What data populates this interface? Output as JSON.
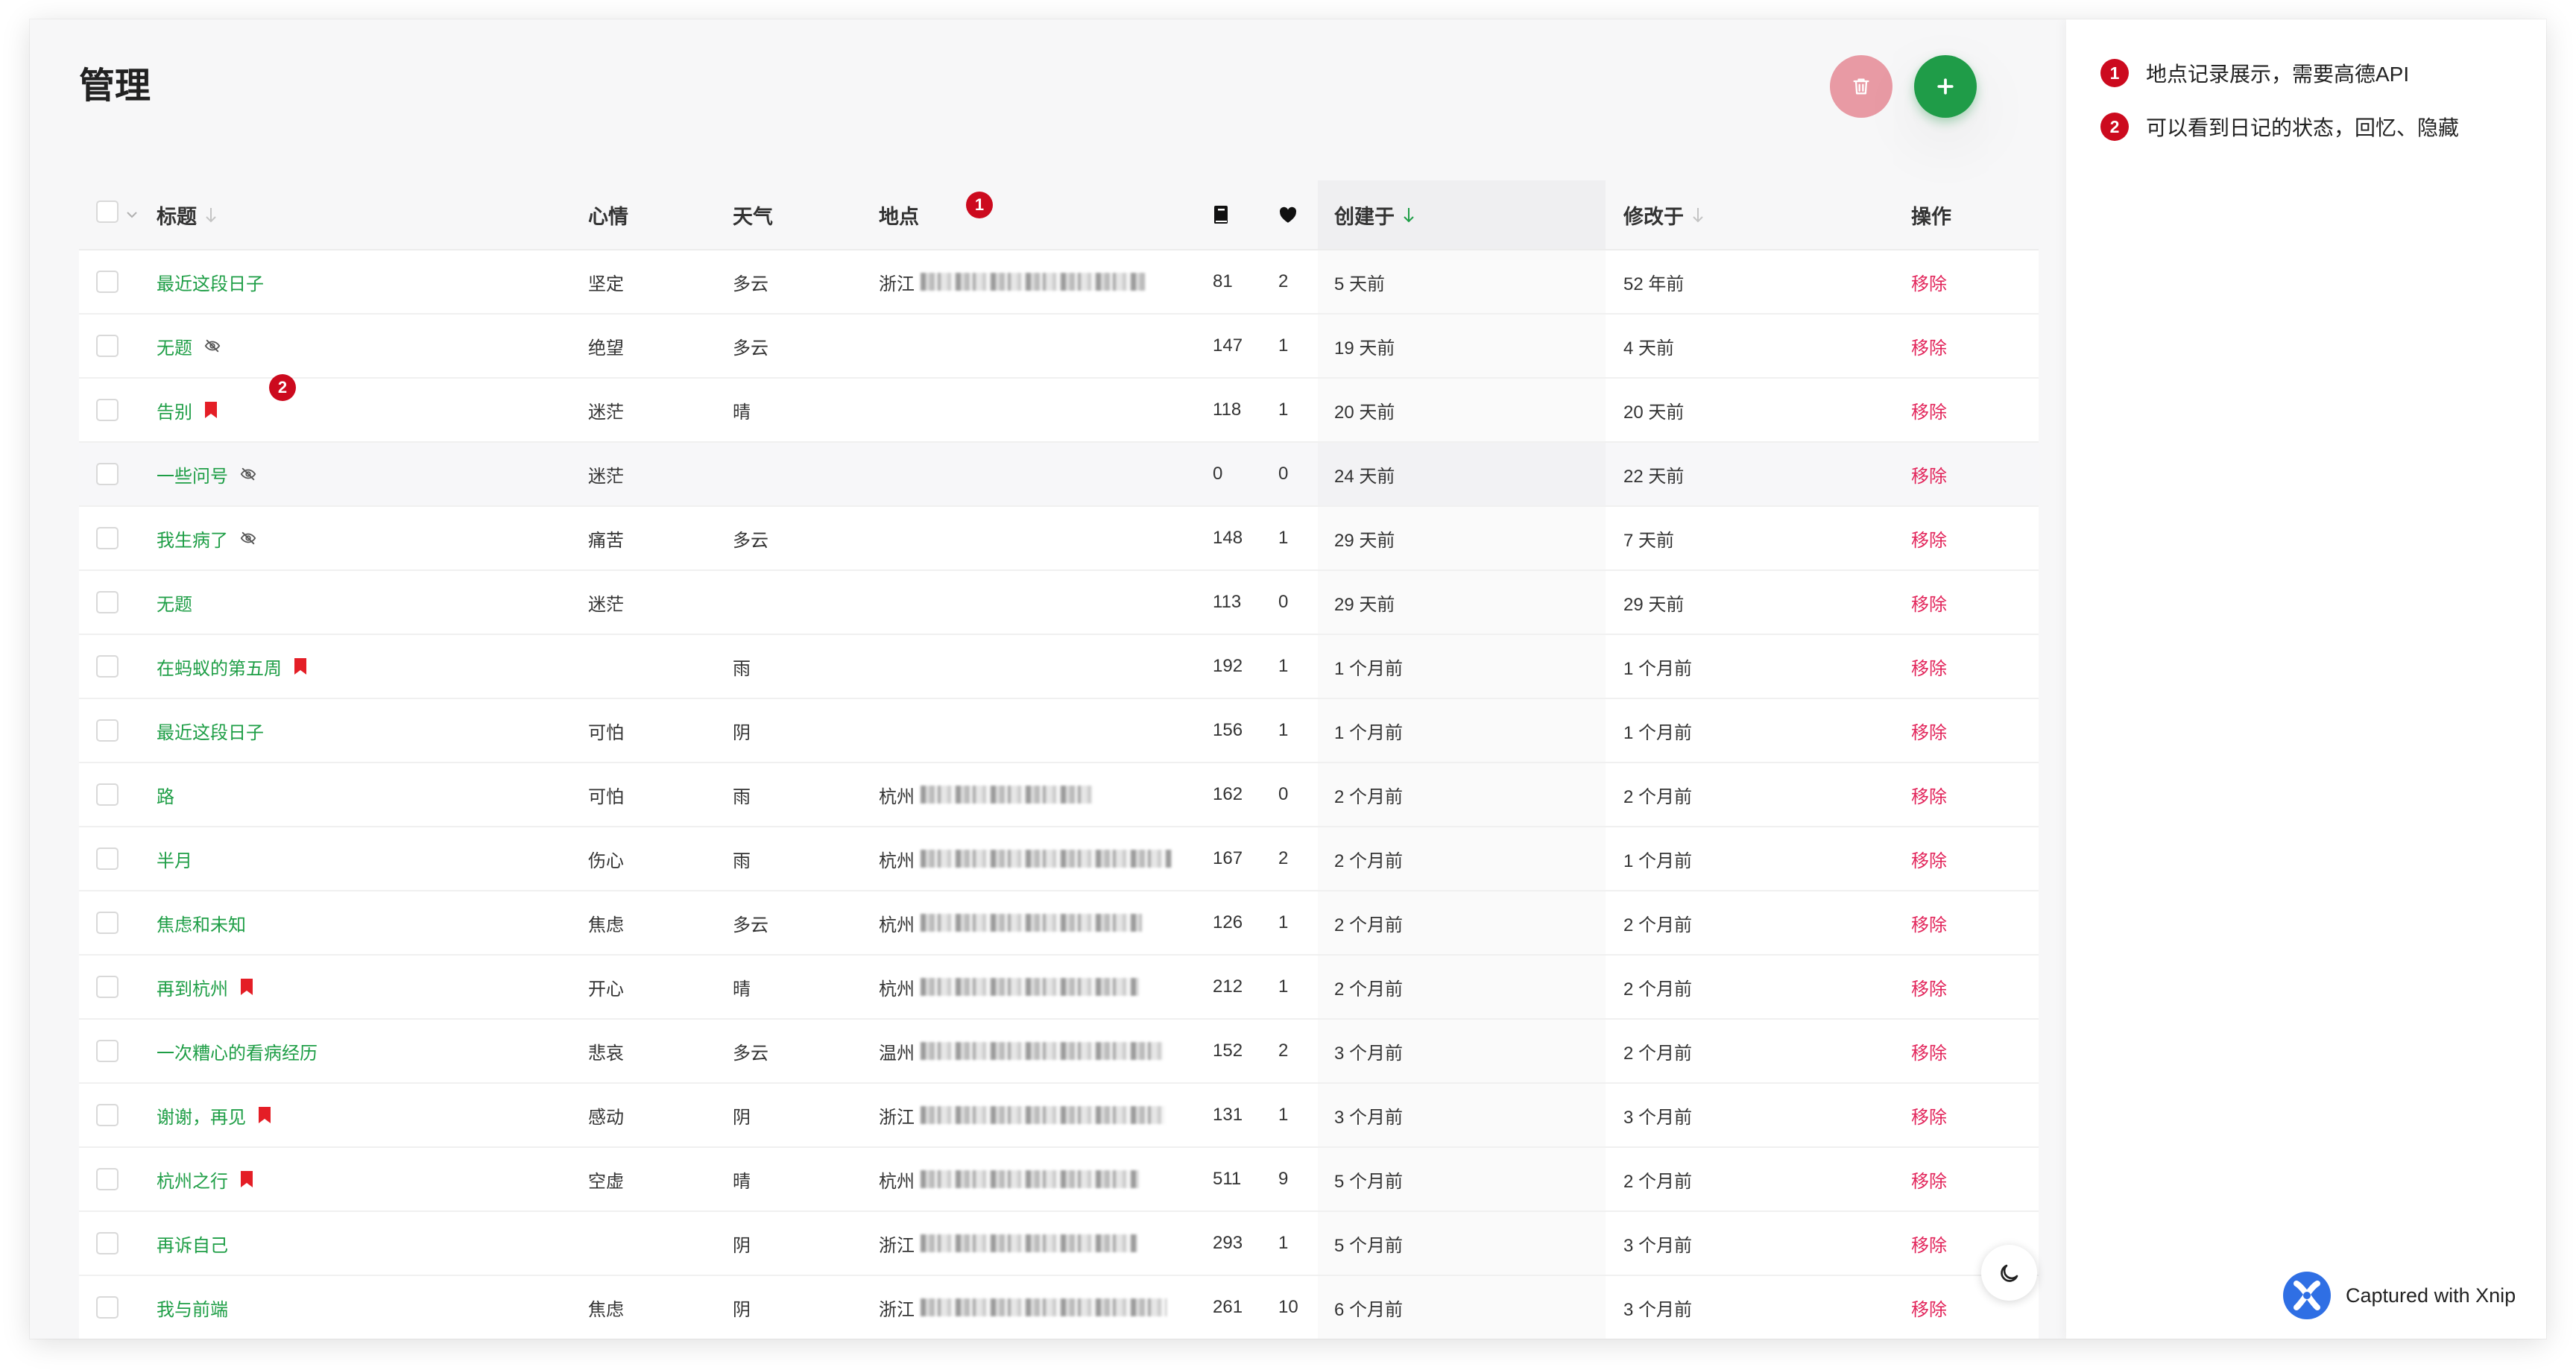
{
  "page": {
    "title": "管理"
  },
  "toolbar": {
    "delete_icon": "trash-icon",
    "add_icon": "plus-icon"
  },
  "callouts": {
    "location": "1",
    "status": "2"
  },
  "table": {
    "columns": {
      "title": "标题",
      "mood": "心情",
      "weather": "天气",
      "location": "地点",
      "words_icon": "book-icon",
      "likes_icon": "heart-icon",
      "created": "创建于",
      "modified": "修改于",
      "actions": "操作"
    },
    "rows": [
      {
        "title": "最近这段日子",
        "status_icon": "",
        "mood": "坚定",
        "weather": "多云",
        "location": "浙江",
        "words": "81",
        "likes": "2",
        "created": "5 天前",
        "modified": "52 年前",
        "action": "移除"
      },
      {
        "title": "无题",
        "status_icon": "eye-slash-icon",
        "mood": "绝望",
        "weather": "多云",
        "location": "",
        "words": "147",
        "likes": "1",
        "created": "19 天前",
        "modified": "4 天前",
        "action": "移除"
      },
      {
        "title": "告别",
        "status_icon": "bookmark-icon",
        "mood": "迷茫",
        "weather": "晴",
        "location": "",
        "words": "118",
        "likes": "1",
        "created": "20 天前",
        "modified": "20 天前",
        "action": "移除"
      },
      {
        "title": "一些问号",
        "status_icon": "eye-slash-icon",
        "mood": "迷茫",
        "weather": "",
        "location": "",
        "words": "0",
        "likes": "0",
        "created": "24 天前",
        "modified": "22 天前",
        "action": "移除",
        "hovered": true
      },
      {
        "title": "我生病了",
        "status_icon": "eye-slash-icon",
        "mood": "痛苦",
        "weather": "多云",
        "location": "",
        "words": "148",
        "likes": "1",
        "created": "29 天前",
        "modified": "7 天前",
        "action": "移除"
      },
      {
        "title": "无题",
        "status_icon": "",
        "mood": "迷茫",
        "weather": "",
        "location": "",
        "words": "113",
        "likes": "0",
        "created": "29 天前",
        "modified": "29 天前",
        "action": "移除"
      },
      {
        "title": "在蚂蚁的第五周",
        "status_icon": "bookmark-icon",
        "mood": "",
        "weather": "雨",
        "location": "",
        "words": "192",
        "likes": "1",
        "created": "1 个月前",
        "modified": "1 个月前",
        "action": "移除"
      },
      {
        "title": "最近这段日子",
        "status_icon": "",
        "mood": "可怕",
        "weather": "阴",
        "location": "",
        "words": "156",
        "likes": "1",
        "created": "1 个月前",
        "modified": "1 个月前",
        "action": "移除"
      },
      {
        "title": "路",
        "status_icon": "",
        "mood": "可怕",
        "weather": "雨",
        "location": "杭州",
        "words": "162",
        "likes": "0",
        "created": "2 个月前",
        "modified": "2 个月前",
        "action": "移除"
      },
      {
        "title": "半月",
        "status_icon": "",
        "mood": "伤心",
        "weather": "雨",
        "location": "杭州",
        "words": "167",
        "likes": "2",
        "created": "2 个月前",
        "modified": "1 个月前",
        "action": "移除"
      },
      {
        "title": "焦虑和未知",
        "status_icon": "",
        "mood": "焦虑",
        "weather": "多云",
        "location": "杭州",
        "words": "126",
        "likes": "1",
        "created": "2 个月前",
        "modified": "2 个月前",
        "action": "移除"
      },
      {
        "title": "再到杭州",
        "status_icon": "bookmark-icon",
        "mood": "开心",
        "weather": "晴",
        "location": "杭州",
        "words": "212",
        "likes": "1",
        "created": "2 个月前",
        "modified": "2 个月前",
        "action": "移除"
      },
      {
        "title": "一次糟心的看病经历",
        "status_icon": "",
        "mood": "悲哀",
        "weather": "多云",
        "location": "温州",
        "words": "152",
        "likes": "2",
        "created": "3 个月前",
        "modified": "2 个月前",
        "action": "移除"
      },
      {
        "title": "谢谢，再见",
        "status_icon": "bookmark-icon",
        "mood": "感动",
        "weather": "阴",
        "location": "浙江",
        "words": "131",
        "likes": "1",
        "created": "3 个月前",
        "modified": "3 个月前",
        "action": "移除"
      },
      {
        "title": "杭州之行",
        "status_icon": "bookmark-icon",
        "mood": "空虚",
        "weather": "晴",
        "location": "杭州",
        "words": "511",
        "likes": "9",
        "created": "5 个月前",
        "modified": "2 个月前",
        "action": "移除"
      },
      {
        "title": "再诉自己",
        "status_icon": "",
        "mood": "",
        "weather": "阴",
        "location": "浙江",
        "words": "293",
        "likes": "1",
        "created": "5 个月前",
        "modified": "3 个月前",
        "action": "移除"
      },
      {
        "title": "我与前端",
        "status_icon": "",
        "mood": "焦虑",
        "weather": "阴",
        "location": "浙江",
        "words": "261",
        "likes": "10",
        "created": "6 个月前",
        "modified": "3 个月前",
        "action": "移除"
      }
    ]
  },
  "annotations": [
    {
      "badge": "1",
      "text": "地点记录展示，需要高德API"
    },
    {
      "badge": "2",
      "text": "可以看到日记的状态，回忆、隐藏"
    }
  ],
  "theme_toggle": {
    "icon": "moon-icon"
  },
  "watermark": {
    "text": "Captured with Xnip",
    "icon": "xnip-logo-icon"
  },
  "colors": {
    "accent_green": "#1e9e46",
    "danger": "#e2245a",
    "bookmark_red": "#e41e26",
    "badge_red": "#cc0a1e",
    "delete_button": "#e89aa4",
    "add_button": "#1f9c48"
  }
}
